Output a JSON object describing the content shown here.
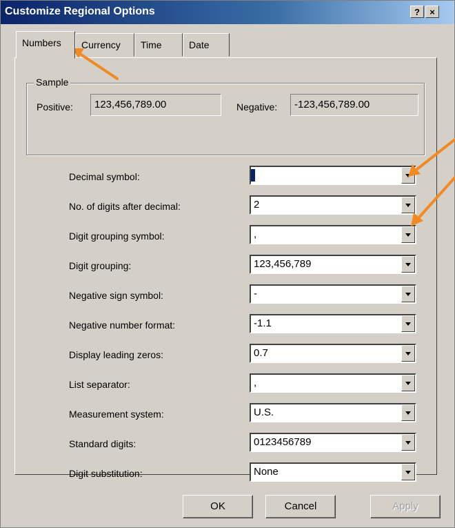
{
  "window": {
    "title": "Customize Regional Options",
    "help_label": "?",
    "close_label": "×"
  },
  "tabs": [
    {
      "label": "Numbers",
      "active": true
    },
    {
      "label": "Currency",
      "active": false
    },
    {
      "label": "Time",
      "active": false
    },
    {
      "label": "Date",
      "active": false
    }
  ],
  "sample": {
    "legend": "Sample",
    "positive_label": "Positive:",
    "positive_value": "123,456,789.00",
    "negative_label": "Negative:",
    "negative_value": "-123,456,789.00"
  },
  "settings": [
    {
      "label": "Decimal symbol:",
      "value": ""
    },
    {
      "label": "No. of digits after decimal:",
      "value": "2"
    },
    {
      "label": "Digit grouping symbol:",
      "value": ","
    },
    {
      "label": "Digit grouping:",
      "value": "123,456,789"
    },
    {
      "label": "Negative sign symbol:",
      "value": "-"
    },
    {
      "label": "Negative number format:",
      "value": "-1.1"
    },
    {
      "label": "Display leading zeros:",
      "value": "0.7"
    },
    {
      "label": "List separator:",
      "value": ","
    },
    {
      "label": "Measurement system:",
      "value": "U.S."
    },
    {
      "label": "Standard digits:",
      "value": "0123456789"
    },
    {
      "label": "Digit substitution:",
      "value": "None"
    }
  ],
  "buttons": {
    "ok": "OK",
    "cancel": "Cancel",
    "apply": "Apply"
  },
  "annotation_color": "#f08a24"
}
